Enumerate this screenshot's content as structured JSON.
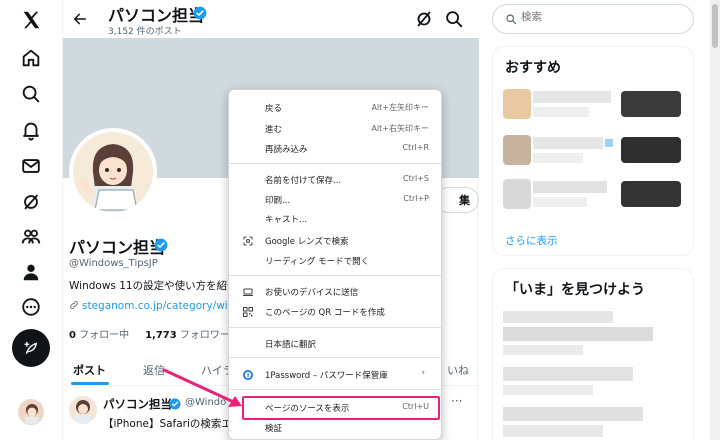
{
  "header": {
    "name": "パソコン担当",
    "post_count": "3,152 件のポスト"
  },
  "profile": {
    "name": "パソコン担当",
    "handle": "@Windows_TipsJP",
    "bio": "Windows 11の設定や使い方を紹介",
    "link": "steganom.co.jp/category/windo",
    "following_count": "0",
    "following_label": "フォロー中",
    "followers_count": "1,773",
    "followers_label": "フォロワー",
    "edit_button_partial": "集"
  },
  "tabs": [
    {
      "label": "ポスト"
    },
    {
      "label": "返信"
    },
    {
      "label": "ハイラ"
    },
    {
      "label": "いね"
    }
  ],
  "post": {
    "name": "パソコン担当",
    "handle": "@Windo",
    "more": "···",
    "text": "【iPhone】Safariの検索エン"
  },
  "search": {
    "placeholder": "検索"
  },
  "recommend": {
    "title": "おすすめ",
    "show_more": "さらに表示"
  },
  "trends": {
    "title": "「いま」を見つけよう"
  },
  "context_menu": {
    "items": [
      {
        "label": "戻る",
        "shortcut": "Alt+左矢印キー"
      },
      {
        "label": "進む",
        "shortcut": "Alt+右矢印キー"
      },
      {
        "label": "再読み込み",
        "shortcut": "Ctrl+R"
      },
      {
        "label": "名前を付けて保存...",
        "shortcut": "Ctrl+S"
      },
      {
        "label": "印刷...",
        "shortcut": "Ctrl+P"
      },
      {
        "label": "キャスト...",
        "shortcut": ""
      },
      {
        "label": "Google レンズで検索",
        "shortcut": "",
        "icon": "google-lens-icon"
      },
      {
        "label": "リーディング モードで開く",
        "shortcut": ""
      },
      {
        "label": "お使いのデバイスに送信",
        "shortcut": "",
        "icon": "laptop-icon"
      },
      {
        "label": "このページの QR コードを作成",
        "shortcut": "",
        "icon": "qr-code-icon"
      },
      {
        "label": "日本語に翻訳",
        "shortcut": ""
      },
      {
        "label": "1Password – パスワード保管庫",
        "shortcut": "",
        "icon": "onepassword-icon",
        "submenu": "›"
      },
      {
        "label": "ページのソースを表示",
        "shortcut": "Ctrl+U"
      },
      {
        "label": "検証",
        "shortcut": ""
      }
    ]
  },
  "colors": {
    "accent": "#1d9bf0",
    "highlight": "#e6227a",
    "banner": "#cfd9de"
  }
}
